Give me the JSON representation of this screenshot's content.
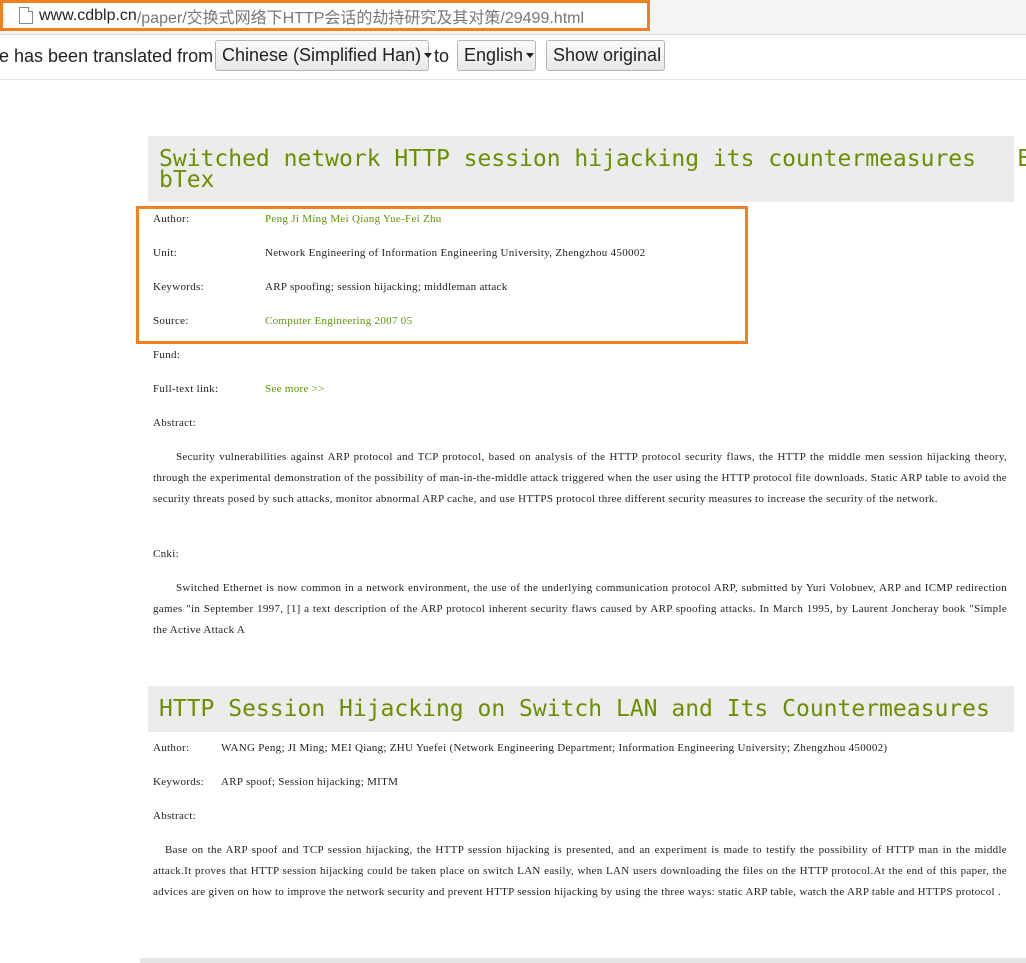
{
  "address_bar": {
    "domain": "www.cdblp.cn",
    "path": "/paper/交换式网络下HTTP会话的劫持研究及其对策/29499.html"
  },
  "translate_bar": {
    "message": "e has been translated from",
    "source_language": "Chinese (Simplified Han)",
    "to_label": "to",
    "target_language": "English",
    "show_original": "Show original"
  },
  "paper1": {
    "title_line1": "Switched network HTTP session hijacking its countermeasures   Bi",
    "title_line2": "bTex",
    "author_label": "Author:",
    "author": "Peng Ji Ming Mei Qiang Yue-Fei Zhu",
    "unit_label": "Unit:",
    "unit": "Network Engineering of Information Engineering University, Zhengzhou 450002",
    "keywords_label": "Keywords:",
    "keywords": "ARP spoofing; session hijacking; middleman attack",
    "source_label": "Source:",
    "source": "Computer Engineering 2007 05",
    "fund_label": "Fund:",
    "fulltext_label": "Full-text link:",
    "fulltext_link": "See more >>",
    "abstract_label": "Abstract:",
    "abstract": "Security vulnerabilities against ARP protocol and TCP protocol, based on analysis of the HTTP protocol security flaws, the HTTP the middle men session hijacking theory, through the experimental demonstration of the possibility of man-in-the-middle attack triggered when the user using the HTTP protocol file downloads. Static ARP table to avoid the security threats posed by such attacks, monitor abnormal ARP cache, and use HTTPS protocol three different security measures to increase the security of the network.",
    "cnki_label": "Cnki:",
    "cnki": "Switched Ethernet is now common in a network environment, the use of the underlying communication protocol ARP, submitted by Yuri Volobuev, ARP and ICMP redirection games \"in September 1997, [1] a text description of the ARP protocol inherent security flaws caused by ARP spoofing attacks. In March 1995, by Laurent Joncheray book \"Simple the Active Attack A"
  },
  "paper2": {
    "title": "HTTP Session Hijacking on Switch LAN and Its Countermeasures",
    "author_label": "Author:",
    "author": "WANG Peng; JI Ming; MEI Qiang; ZHU Yuefei (Network Engineering Department; Information Engineering University; Zhengzhou 450002)",
    "keywords_label": "Keywords:",
    "keywords": "ARP spoof; Session hijacking; MITM",
    "abstract_label": "Abstract:",
    "abstract": "Base on the ARP spoof and TCP session hijacking, the HTTP session hijacking is presented, and an experiment is made to testify the possibility of HTTP man in the middle attack.It proves that HTTP session hijacking could be taken place on switch LAN easily, when LAN users downloading the files on the HTTP protocol.At the end of this paper, the advices are given on how to improve the network security and prevent HTTP session hijacking by using the three ways: static ARP table, watch the ARP table and HTTPS protocol ."
  },
  "colors": {
    "title_green": "#6a8f00",
    "link_green": "#5e9400",
    "highlight_orange": "#f08020"
  }
}
